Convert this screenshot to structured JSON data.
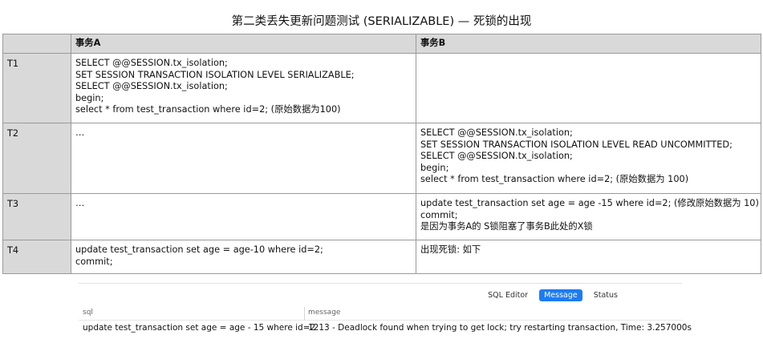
{
  "title": "第二类丢失更新问题测试 (SERIALIZABLE) — 死锁的出现",
  "table": {
    "headers": [
      "",
      "事务A",
      "事务B"
    ],
    "rows": [
      {
        "label": "T1",
        "a": [
          "SELECT @@SESSION.tx_isolation;",
          "SET SESSION TRANSACTION ISOLATION LEVEL SERIALIZABLE;",
          "SELECT @@SESSION.tx_isolation;",
          "begin;",
          "select * from test_transaction where id=2; (原始数据为100)"
        ],
        "b": []
      },
      {
        "label": "T2",
        "a": [
          "…"
        ],
        "b": [
          "SELECT @@SESSION.tx_isolation;",
          "SET SESSION TRANSACTION ISOLATION LEVEL READ UNCOMMITTED;",
          "SELECT @@SESSION.tx_isolation;",
          "begin;",
          "select * from test_transaction where id=2; (原始数据为 100)"
        ]
      },
      {
        "label": "T3",
        "a": [
          "…"
        ],
        "b": [
          "update test_transaction set age = age -15 where id=2; (修改原始数据为 10)",
          "commit;",
          "是因为事务A的 S锁阻塞了事务B此处的X锁"
        ]
      },
      {
        "label": "T4",
        "a": [
          "update test_transaction set age = age-10 where id=2;",
          "commit;"
        ],
        "b": [
          "出现死锁: 如下"
        ]
      }
    ]
  },
  "result_panel": {
    "tabs": [
      {
        "label": "SQL Editor",
        "active": false
      },
      {
        "label": "Message",
        "active": true
      },
      {
        "label": "Status",
        "active": false
      }
    ],
    "columns": [
      "sql",
      "message"
    ],
    "row": {
      "sql": "update test_transaction set age = age - 15 where id=2",
      "message": "1213 - Deadlock found when trying to get lock; try restarting transaction, Time: 3.257000s"
    }
  }
}
